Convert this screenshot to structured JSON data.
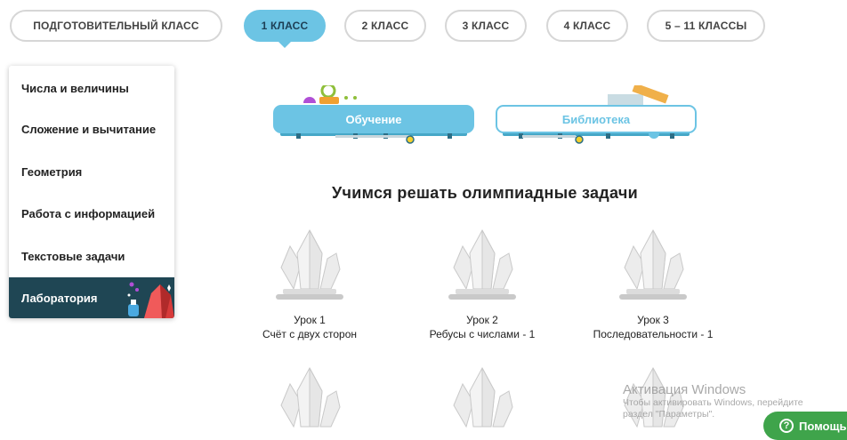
{
  "tabs": [
    {
      "label": "ПОДГОТОВИТЕЛЬНЫЙ КЛАСС",
      "active": false
    },
    {
      "label": "1 КЛАСС",
      "active": true
    },
    {
      "label": "2 КЛАСС",
      "active": false
    },
    {
      "label": "3 КЛАСС",
      "active": false
    },
    {
      "label": "4 КЛАСС",
      "active": false
    },
    {
      "label": "5 – 11 КЛАССЫ",
      "active": false
    }
  ],
  "sidebar": {
    "items": [
      {
        "label": "Числа и величины"
      },
      {
        "label": "Сложение и вычитание"
      },
      {
        "label": "Геометрия"
      },
      {
        "label": "Работа с информацией"
      },
      {
        "label": "Текстовые задачи"
      },
      {
        "label": "Лаборатория",
        "selected": true,
        "icon": "crystal-lab-icon"
      }
    ]
  },
  "modes": {
    "learning_label": "Обучение",
    "library_label": "Библиотека"
  },
  "heading": "Учимся решать олимпиадные задачи",
  "lessons": [
    {
      "number": "Урок 1",
      "title": "Счёт с двух сторон",
      "icon": "crystal-icon"
    },
    {
      "number": "Урок 2",
      "title": "Ребусы с числами - 1",
      "icon": "crystal-icon"
    },
    {
      "number": "Урок 3",
      "title": "Последовательности - 1",
      "icon": "crystal-icon"
    }
  ],
  "activation": {
    "title": "Активация Windows",
    "line1": "Чтобы активировать Windows, перейдите",
    "line2": "раздел \"Параметры\"."
  },
  "help": {
    "label": "Помощь",
    "icon": "question-icon"
  },
  "colors": {
    "accent": "#6cc4e4",
    "sidebar_selected": "#1f4654",
    "help_button": "#3fa44b"
  }
}
